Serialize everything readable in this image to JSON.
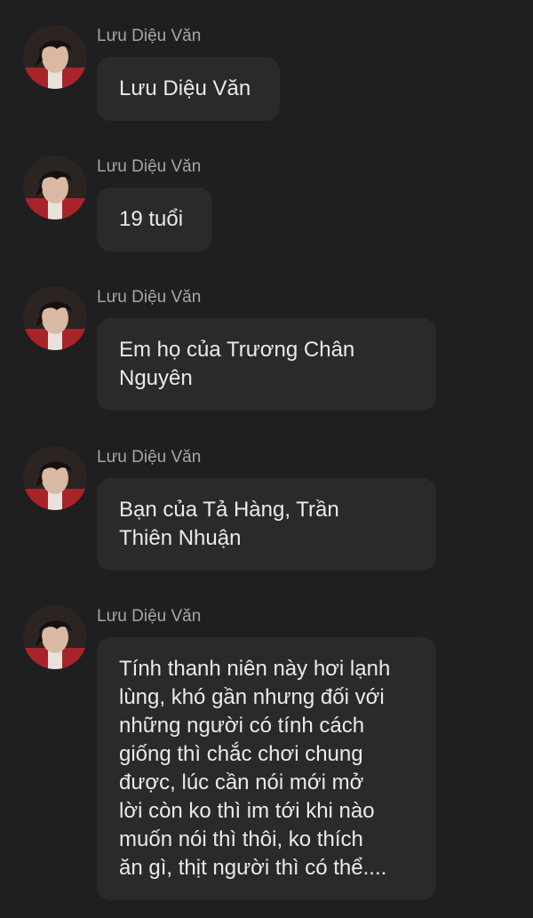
{
  "messages": [
    {
      "sender": "Lưu Diệu Văn",
      "text": "Lưu Diệu Văn",
      "avatar_icon": "user-avatar-icon"
    },
    {
      "sender": "Lưu Diệu Văn",
      "text": "19 tuổi",
      "avatar_icon": "user-avatar-icon"
    },
    {
      "sender": "Lưu Diệu Văn",
      "text": "Em họ của Trương Chân\nNguyên",
      "avatar_icon": "user-avatar-icon"
    },
    {
      "sender": "Lưu Diệu Văn",
      "text": "Bạn của Tả Hàng, Trần\nThiên Nhuận",
      "avatar_icon": "user-avatar-icon"
    },
    {
      "sender": "Lưu Diệu Văn",
      "text": "Tính thanh niên này hơi lạnh\nlùng, khó gần nhưng đối với\nnhững người có tính cách\ngiống thì chắc chơi chung\nđược, lúc cần nói mới mở\nlời còn ko thì im tới khi nào\nmuốn nói thì thôi, ko thích\năn gì, thịt người thì có thể....",
      "avatar_icon": "user-avatar-icon"
    }
  ],
  "colors": {
    "background": "#1f1f1f",
    "bubble": "#2a2a2a",
    "sender_text": "#a7a7a7",
    "message_text": "#eaeaea"
  }
}
